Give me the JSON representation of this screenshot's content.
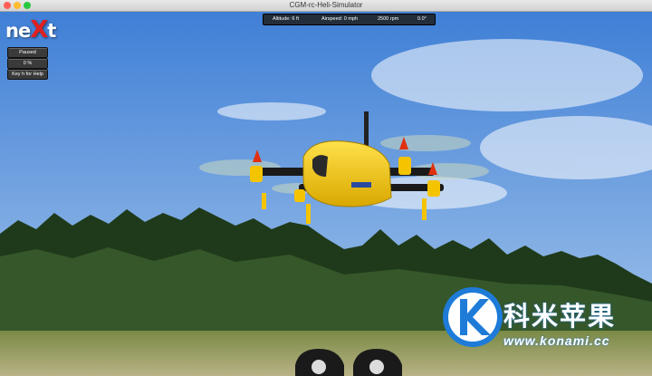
{
  "window": {
    "title": "CGM-rc-Heli-Simulator"
  },
  "logo": {
    "prefix": "ne",
    "x": "X",
    "suffix": "t"
  },
  "side_buttons": [
    {
      "label": "Paused"
    },
    {
      "label": "0 %"
    },
    {
      "label": "Key h for Help"
    }
  ],
  "hud": {
    "altitude": "Altitude: 6 ft",
    "airspeed": "Airspeed: 0 mph",
    "rpm": "2500 rpm",
    "angle": "0.0°"
  },
  "watermark": {
    "chinese": "科米苹果",
    "url": "www.konami.cc"
  },
  "colors": {
    "sky_top": "#3f7fd6",
    "sky_bottom": "#a9c9ec",
    "drone": "#f5c400",
    "accent": "#e02020",
    "watermark_blue": "#1e7bd8"
  }
}
